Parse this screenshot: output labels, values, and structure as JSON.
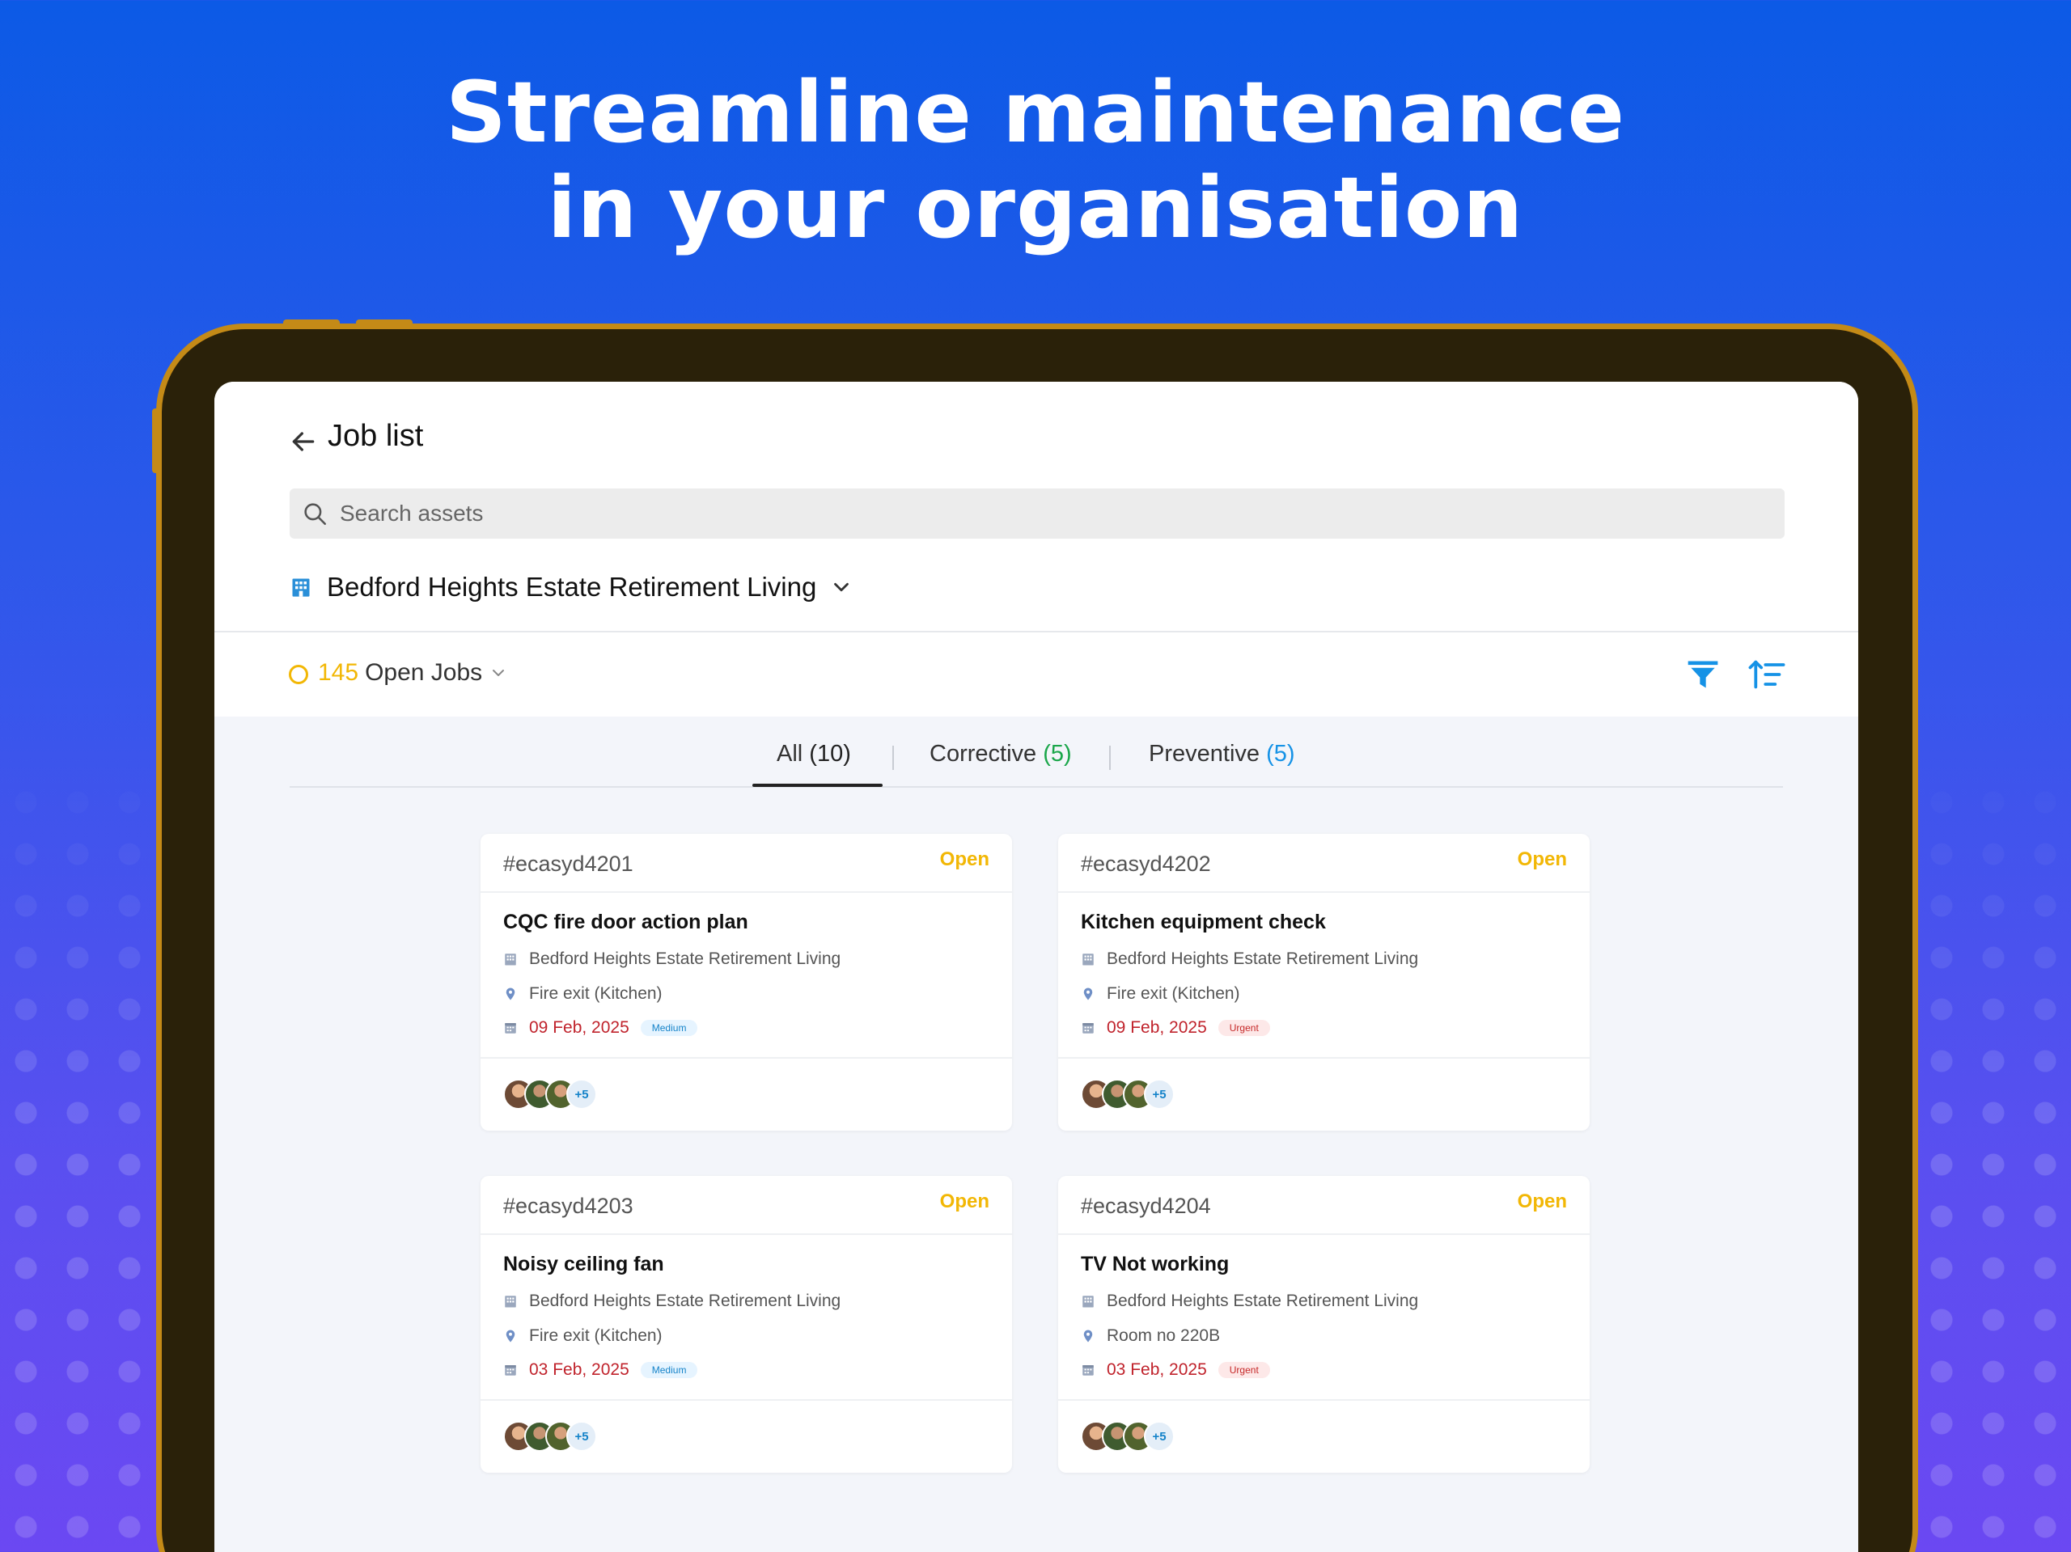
{
  "headline": {
    "line1": "Streamline maintenance",
    "line2": "in your organisation"
  },
  "header": {
    "title": "Job list"
  },
  "search": {
    "placeholder": "Search assets"
  },
  "site": {
    "name": "Bedford Heights Estate Retirement Living"
  },
  "jobs_bar": {
    "count": "145",
    "label": "Open Jobs"
  },
  "tabs": [
    {
      "label": "All",
      "count": "(10)"
    },
    {
      "label": "Corrective",
      "count": "(5)"
    },
    {
      "label": "Preventive",
      "count": "(5)"
    }
  ],
  "jobs": [
    {
      "id": "#ecasyd4201",
      "status": "Open",
      "title": "CQC fire door action plan",
      "site": "Bedford Heights Estate Retirement Living",
      "location": "Fire exit (Kitchen)",
      "date": "09 Feb, 2025",
      "priority": "Medium",
      "more_assignees": "+5"
    },
    {
      "id": "#ecasyd4202",
      "status": "Open",
      "title": "Kitchen equipment check",
      "site": "Bedford Heights Estate Retirement Living",
      "location": "Fire exit (Kitchen)",
      "date": "09 Feb, 2025",
      "priority": "Urgent",
      "more_assignees": "+5"
    },
    {
      "id": "#ecasyd4203",
      "status": "Open",
      "title": "Noisy ceiling fan",
      "site": "Bedford Heights Estate Retirement Living",
      "location": "Fire exit (Kitchen)",
      "date": "03 Feb, 2025",
      "priority": "Medium",
      "more_assignees": "+5"
    },
    {
      "id": "#ecasyd4204",
      "status": "Open",
      "title": "TV Not working",
      "site": "Bedford Heights Estate Retirement Living",
      "location": "Room no 220B",
      "date": "03 Feb, 2025",
      "priority": "Urgent",
      "more_assignees": "+5"
    }
  ],
  "colors": {
    "background_top": "#0c5ae6",
    "background_bottom": "#6b48f2",
    "tablet_frame": "#c48a17",
    "open_status": "#f2b705",
    "corrective": "#1aa64a",
    "preventive": "#1592e6",
    "date": "#c0232c",
    "filter_icon": "#1592e6"
  },
  "icons": {
    "back": "arrow-left-icon",
    "search": "search-icon",
    "site": "building-icon",
    "dropdown": "chevron-down-icon",
    "filter": "filter-icon",
    "sort": "sort-icon",
    "location": "map-pin-icon",
    "date": "calendar-icon"
  }
}
